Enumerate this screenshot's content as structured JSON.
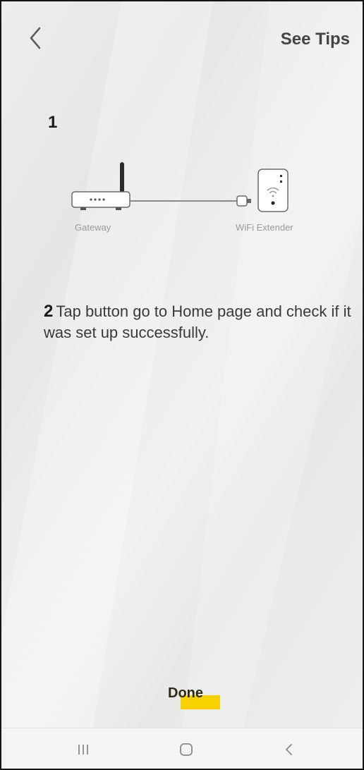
{
  "header": {
    "back_icon": "chevron-left-icon",
    "see_tips_label": "See Tips"
  },
  "step1": {
    "number": "1",
    "gateway_label": "Gateway",
    "extender_label": "WiFi Extender"
  },
  "step2": {
    "number": "2",
    "text": "Tap button go to Home page and check if it was set up successfully."
  },
  "footer": {
    "done_label": "Done",
    "done_highlight_color": "#f7d100"
  },
  "system_nav": {
    "recents_icon": "recents-icon",
    "home_icon": "home-icon",
    "back_icon": "back-icon"
  }
}
